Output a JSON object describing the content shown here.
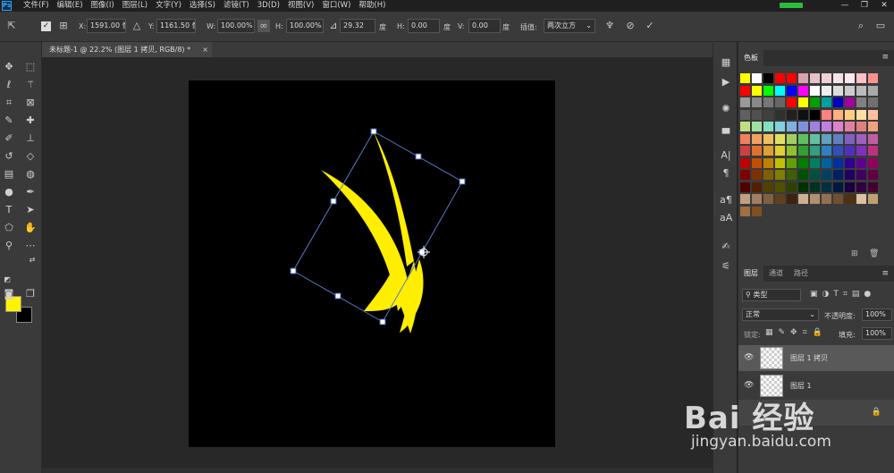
{
  "menubar": {
    "logo": "Ps",
    "items": [
      "文件(F)",
      "编辑(E)",
      "图像(I)",
      "图层(L)",
      "文字(Y)",
      "选择(S)",
      "滤镜(T)",
      "3D(D)",
      "视图(V)",
      "窗口(W)",
      "帮助(H)"
    ],
    "window_controls": [
      "—",
      "❐",
      "✕"
    ]
  },
  "options": {
    "x_label": "X:",
    "x_value": "1591.00 像",
    "y_label": "Y:",
    "y_value": "1161.50 像",
    "w_label": "W:",
    "w_value": "100.00%",
    "h_label": "H:",
    "h_value": "100.00%",
    "angle_value": "29.32",
    "angle_unit": "度",
    "hskew_label": "H:",
    "hskew_value": "0.00",
    "hskew_unit": "度",
    "vskew_label": "V:",
    "vskew_value": "0.00",
    "vskew_unit": "度",
    "interp_label": "插值:",
    "interp_value": "两次立方"
  },
  "document": {
    "tab_title": "未标题-1 @ 22.2% (图层 1 拷贝, RGB/8) *",
    "close": "×"
  },
  "panels": {
    "swatches_tab": "色板",
    "layers_tab": "图层",
    "channels_tab": "通道",
    "paths_tab": "路径",
    "kind_placeholder": "类型",
    "blend_mode": "正常",
    "opacity_label": "不透明度:",
    "opacity_value": "100%",
    "lock_label": "锁定:",
    "fill_label": "填充:",
    "fill_value": "100%"
  },
  "layers": [
    {
      "name": "图层 1 拷贝",
      "selected": true
    },
    {
      "name": "图层 1",
      "selected": false
    }
  ],
  "watermark": {
    "brand": "Bai 经验",
    "url": "jingyan.baidu.com"
  },
  "colors": {
    "foreground": "#fff200",
    "background": "#000000",
    "shape": "#ffee00"
  }
}
